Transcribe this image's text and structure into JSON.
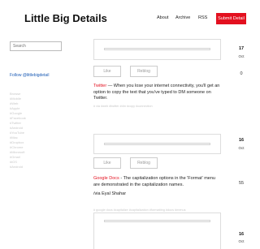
{
  "site": {
    "title": "Little Big Details"
  },
  "nav": {
    "about": "About",
    "archive": "Archive",
    "rss": "RSS",
    "submit": "Submit Detail"
  },
  "sidebar": {
    "search_placeholder": "Search",
    "follow": "Follow @littlebigdetail",
    "tags": [
      "Browse",
      "#Mobile",
      "#Web",
      "#Apple",
      "#Google",
      "#Facebook",
      "#Twitter",
      "#Android",
      "#YouTube",
      "#Mac",
      "#Dropbox",
      "#Chrome",
      "#Microsoft",
      "#Gmail",
      "#iOS",
      "#Android"
    ]
  },
  "posts": [
    {
      "like": "Like",
      "reblog": "Reblog",
      "source": "Twitter",
      "text": " — When you lose your internet connectivity, you'll get an option to copy the text that you've typed to DM someone on Twitter.",
      "meta": "# via #web #twitter #dm #copy #connection",
      "via": "",
      "date_day": "17",
      "date_month": "Oct",
      "note_count": "0"
    },
    {
      "like": "Like",
      "reblog": "Reblog",
      "source": "Google Docs",
      "text": " - The capitalization options in the 'Format' menu are demonstrated in the capitalization names.",
      "meta": "# google docs #capitalize #capitalization #formatting #docs #menus",
      "via": "/via Eyal Shahar",
      "date_day": "16",
      "date_month": "Oct",
      "note_count": "55"
    },
    {
      "date_day": "16",
      "date_month": "Oct"
    }
  ]
}
